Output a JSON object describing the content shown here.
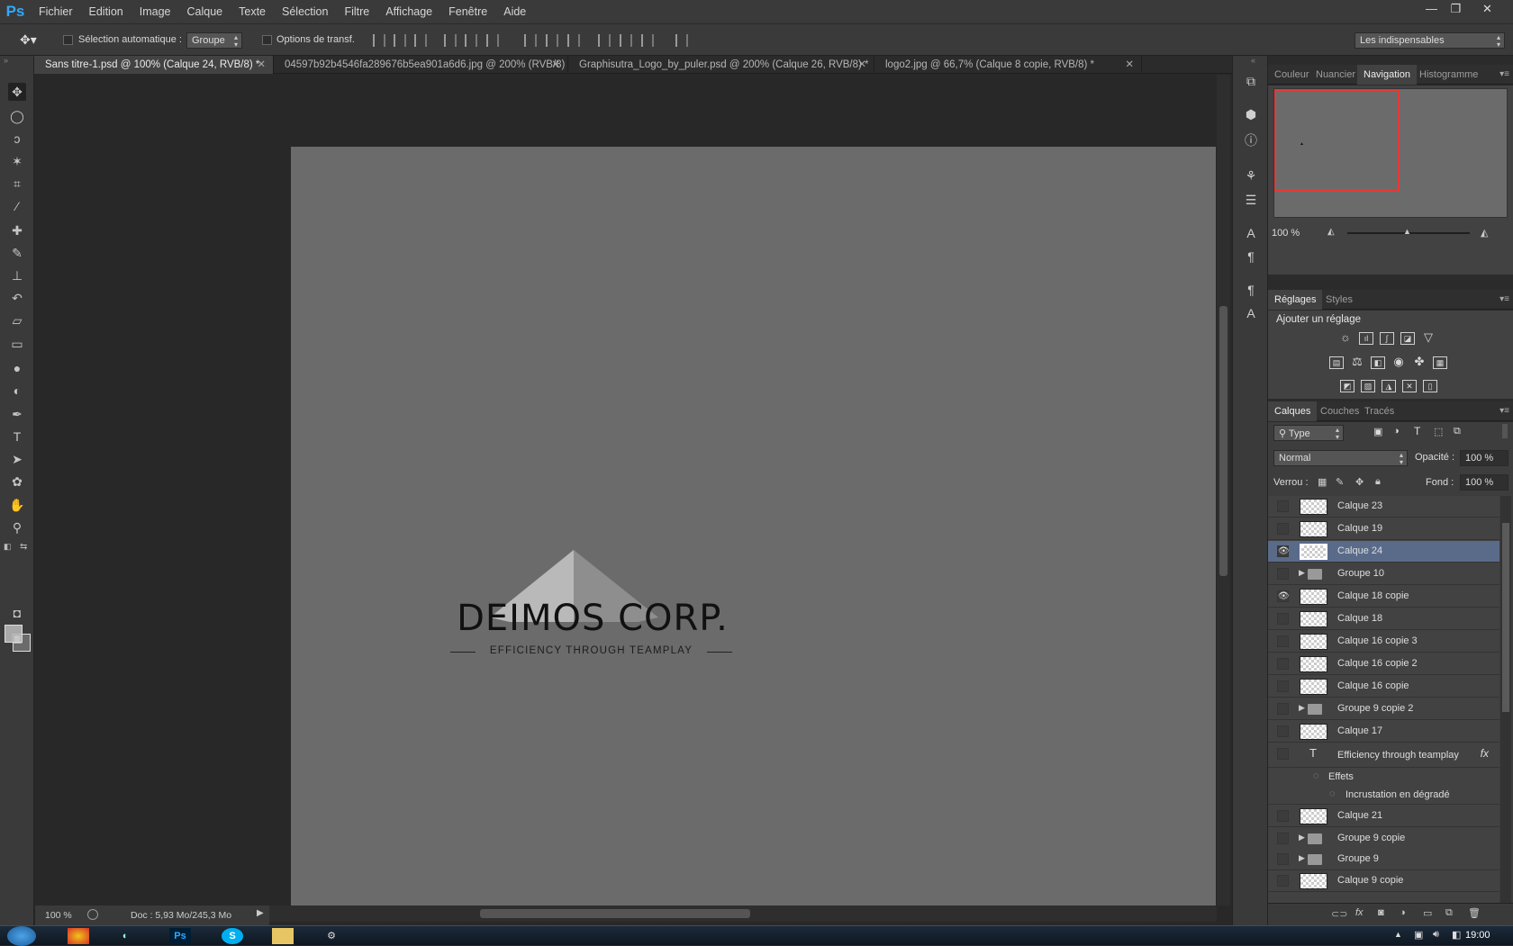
{
  "app": {
    "logo": "Ps"
  },
  "menu": [
    "Fichier",
    "Edition",
    "Image",
    "Calque",
    "Texte",
    "Sélection",
    "Filtre",
    "Affichage",
    "Fenêtre",
    "Aide"
  ],
  "window_controls": [
    "—",
    "❐",
    "✕"
  ],
  "options": {
    "auto_select_label": "Sélection automatique :",
    "auto_select_value": "Groupe",
    "transform_label": "Options de transf.",
    "workspace_value": "Les indispensables"
  },
  "tabs": [
    {
      "label": "Sans titre-1.psd @ 100% (Calque 24, RVB/8) *",
      "close": "✕"
    },
    {
      "label": "04597b92b4546fa289676b5ea901a6d6.jpg @ 200% (RVB/8)",
      "close": "✕"
    },
    {
      "label": "Graphisutra_Logo_by_puler.psd @ 200% (Calque 26, RVB/8) *",
      "close": "✕"
    },
    {
      "label": "logo2.jpg @ 66,7% (Calque 8 copie, RVB/8) *",
      "close": "✕"
    }
  ],
  "canvas": {
    "logo_title": "DEIMOS CORP.",
    "logo_tagline": "EFFICIENCY THROUGH TEAMPLAY"
  },
  "status": {
    "zoom": "100 %",
    "doc": "Doc : 5,93 Mo/245,3 Mo"
  },
  "nav_panel": {
    "tabs": [
      "Couleur",
      "Nuancier",
      "Navigation",
      "Histogramme"
    ],
    "active": "Navigation",
    "zoom": "100 %"
  },
  "adjust_panel": {
    "tabs": [
      "Réglages",
      "Styles"
    ],
    "active": "Réglages",
    "title": "Ajouter un réglage"
  },
  "layers_panel": {
    "tabs": [
      "Calques",
      "Couches",
      "Tracés"
    ],
    "active": "Calques",
    "filter": "Type",
    "blend_mode": "Normal",
    "opacity_label": "Opacité :",
    "opacity_value": "100 %",
    "lock_label": "Verrou :",
    "fill_label": "Fond :",
    "fill_value": "100 %",
    "layers": [
      {
        "name": "Calque 23",
        "kind": "pixel",
        "visible": false
      },
      {
        "name": "Calque 19",
        "kind": "pixel",
        "visible": false
      },
      {
        "name": "Calque 24",
        "kind": "pixel",
        "visible": true,
        "selected": true
      },
      {
        "name": "Groupe 10",
        "kind": "group",
        "visible": false
      },
      {
        "name": "Calque 18 copie",
        "kind": "pixel",
        "visible": true
      },
      {
        "name": "Calque 18",
        "kind": "pixel",
        "visible": false
      },
      {
        "name": "Calque 16 copie 3",
        "kind": "pixel",
        "visible": false
      },
      {
        "name": "Calque 16 copie 2",
        "kind": "pixel",
        "visible": false
      },
      {
        "name": "Calque 16 copie",
        "kind": "pixel",
        "visible": false
      },
      {
        "name": "Groupe 9 copie 2",
        "kind": "group",
        "visible": false
      },
      {
        "name": "Calque 17",
        "kind": "pixel",
        "visible": false
      },
      {
        "name": "Efficiency through teamplay",
        "kind": "text",
        "visible": false,
        "fx": "fx"
      },
      {
        "name": "Effets",
        "kind": "effect-head"
      },
      {
        "name": "Incrustation en dégradé",
        "kind": "effect"
      },
      {
        "name": "Calque 21",
        "kind": "pixel",
        "visible": false
      },
      {
        "name": "Groupe 9 copie",
        "kind": "group",
        "visible": false
      },
      {
        "name": "Groupe 9",
        "kind": "group",
        "visible": false
      },
      {
        "name": "Calque 9 copie",
        "kind": "pixel",
        "visible": false
      }
    ]
  },
  "taskbar": {
    "clock": "19:00"
  }
}
